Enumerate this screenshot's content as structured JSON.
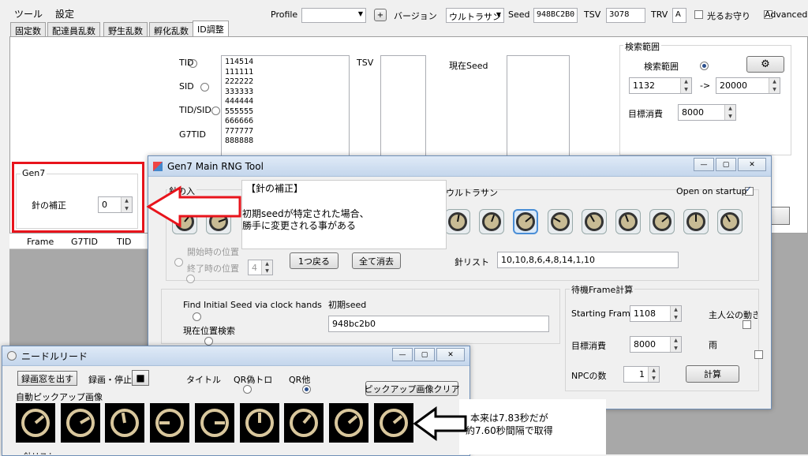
{
  "menu": {
    "tool": "ツール",
    "settings": "設定"
  },
  "toolbar": {
    "profile_label": "Profile",
    "profile_value": "",
    "plus": "+",
    "version_label": "バージョン",
    "version_value": "ウルトラサン",
    "seed_label": "Seed",
    "seed_value": "948BC2B0",
    "tsv_label": "TSV",
    "tsv_value": "3078",
    "trv_label": "TRV",
    "trv_value": "A",
    "charm_label": "光るお守り",
    "advanced_label": "Advanced"
  },
  "tabs": [
    "固定数",
    "配達員乱数",
    "野生乱数",
    "孵化乱数",
    "ID調整"
  ],
  "id_panel": {
    "tid": "TID",
    "sid": "SID",
    "tidsid": "TID/SID",
    "g7tid": "G7TID",
    "list": [
      "114514",
      "111111",
      "222222",
      "333333",
      "444444",
      "555555",
      "666666",
      "777777",
      "888888"
    ],
    "tsv_label": "TSV",
    "current_seed_label": "現在Seed"
  },
  "search_range": {
    "title": "検索範囲",
    "radio": "検索範囲",
    "from": "1132",
    "arrow": "->",
    "to": "20000",
    "target_label": "目標消費",
    "target_value": "8000"
  },
  "gen7_group": {
    "title": "Gen7",
    "correction_label": "針の補正",
    "correction_value": "0"
  },
  "results_table": {
    "headers": [
      "Frame",
      "G7TID",
      "TID"
    ]
  },
  "rng_tool": {
    "title": "Gen7 Main RNG Tool",
    "partial_label": "針の入",
    "ultrasun_label": "ウルトラサン",
    "open_startup": "Open on startup",
    "start_pos": "開始時の位置",
    "end_pos": "終了時の位置",
    "end_value": "4",
    "back_button": "1つ戻る",
    "clear_button": "全て消去",
    "needle_list_label": "針リスト",
    "needle_list_value": "10,10,8,6,4,8,14,1,10",
    "find_seed": "Find Initial Seed via clock hands",
    "current_search": "現在位置検索",
    "initial_seed_label": "初期seed",
    "initial_seed_value": "948bc2b0",
    "frame_calc_title": "待機Frame計算",
    "starting_frame_label": "Starting Frame",
    "starting_frame_value": "1108",
    "protagonist_label": "主人公の動き",
    "target_label": "目標消費",
    "target_value": "8000",
    "rain_label": "雨",
    "npc_label": "NPCの数",
    "npc_value": "1",
    "calc_button": "計算"
  },
  "annotation1": {
    "title": "【針の補正】",
    "line1": "初期seedが特定された場合、",
    "line2": "勝手に変更される事がある"
  },
  "needle_reader": {
    "title": "ニードルリード",
    "record_window_button": "録画窓を出す",
    "record_stop_label": "録画・停止",
    "stop_icon": "■",
    "title_radio": "タイトル",
    "qr_fake": "QR偽トロ",
    "qr_other": "QR他",
    "clear_button": "ピックアップ画像クリア",
    "auto_pick_label": "自動ピックアップ画像",
    "bottom_label": "針リスト"
  },
  "annotation2": {
    "line1": "本来は7.83秒だが",
    "line2": "約7.60秒間隔で取得"
  },
  "colors": {
    "red_box": "#e8141c",
    "window_border": "#6f8fb7"
  }
}
